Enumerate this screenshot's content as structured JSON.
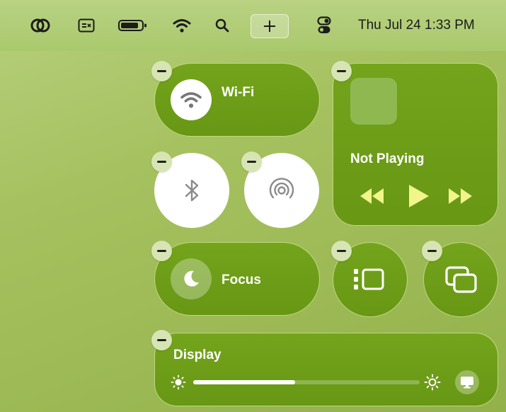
{
  "menubar": {
    "clock": "Thu Jul 24 1:33 PM",
    "icons": [
      "creative-cloud-icon",
      "keyboard-input-icon",
      "battery-icon",
      "wifi-icon",
      "search-icon",
      "add-icon",
      "control-center-icon"
    ]
  },
  "control_center": {
    "wifi": {
      "label": "Wi-Fi"
    },
    "now_playing": {
      "status": "Not Playing"
    },
    "focus": {
      "label": "Focus"
    },
    "display": {
      "label": "Display",
      "brightness": 0.45
    }
  },
  "colors": {
    "tile": "#6f9e18",
    "tile_border": "#e1f0aa",
    "background": "#a6c260",
    "media_accent": "#f2f58a"
  }
}
